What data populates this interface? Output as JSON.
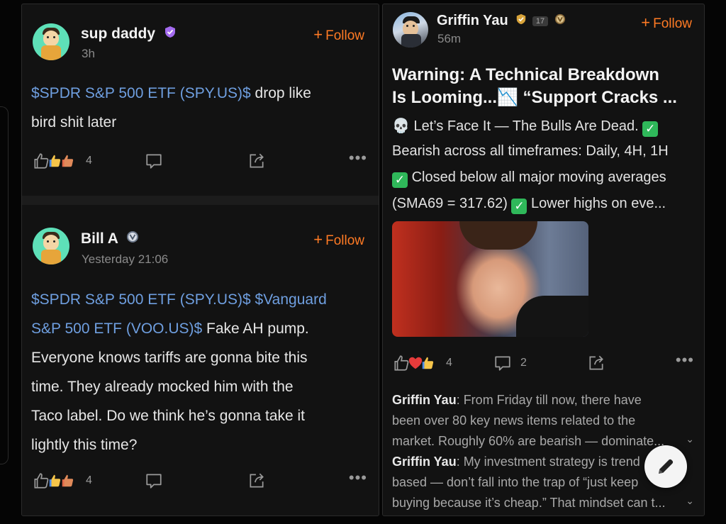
{
  "left_column": {
    "post_1": {
      "username": "sup daddy",
      "timestamp": "3h",
      "follow_label": "Follow",
      "ticker_1": "$SPDR S&P 500 ETF (SPY.US)$",
      "text_after_ticker": " drop like",
      "text_line_2": "bird shit later",
      "reactions_count": "4"
    },
    "post_2": {
      "username": "Bill A",
      "timestamp": "Yesterday 21:06",
      "follow_label": "Follow",
      "ticker_1": "$SPDR S&P 500 ETF (SPY.US)$",
      "ticker_2_part1": "$Vanguard",
      "ticker_2_part2": "S&P 500 ETF (VOO.US)$",
      "text_line_2_rest": " Fake AH pump.",
      "text_line_3": "Everyone knows tariffs are gonna bite this",
      "text_line_4": "time. They already mocked him with the",
      "text_line_5": "Taco label. Do we think he’s gonna take it",
      "text_line_6": "lightly this time?",
      "reactions_count": "4"
    }
  },
  "right_column": {
    "post": {
      "username": "Griffin Yau",
      "level_badge": "17",
      "timestamp": "56m",
      "follow_label": "Follow",
      "title_line_1": "Warning: A Technical Breakdown",
      "title_line_2": "Is Looming...📉 “Support Cracks ...",
      "preview_1": "💀 Let’s Face It — The Bulls Are Dead.",
      "preview_2": "Bearish across all timeframes: Daily, 4H, 1H",
      "preview_3": "Closed below all major moving averages",
      "preview_4a": "(SMA69 = 317.62)",
      "preview_4b": "Lower highs on eve...",
      "reactions_count": "4",
      "comments_count": "2"
    },
    "comments": [
      {
        "author": "Griffin Yau",
        "text_1": ": From Friday till now, there have",
        "text_2": "been over 80 key news items related to the",
        "text_3": "market. Roughly 60% are bearish — dominate..."
      },
      {
        "author": "Griffin Yau",
        "text_1": ": My investment strategy is trend",
        "text_2": "based — don’t fall into the trap of “just keep",
        "text_3": "buying because it’s cheap.” That mindset can t..."
      }
    ]
  },
  "colors": {
    "accent_follow": "#ff7a24",
    "ticker_link": "#6f9fe0",
    "check_green": "#2fb85a"
  }
}
